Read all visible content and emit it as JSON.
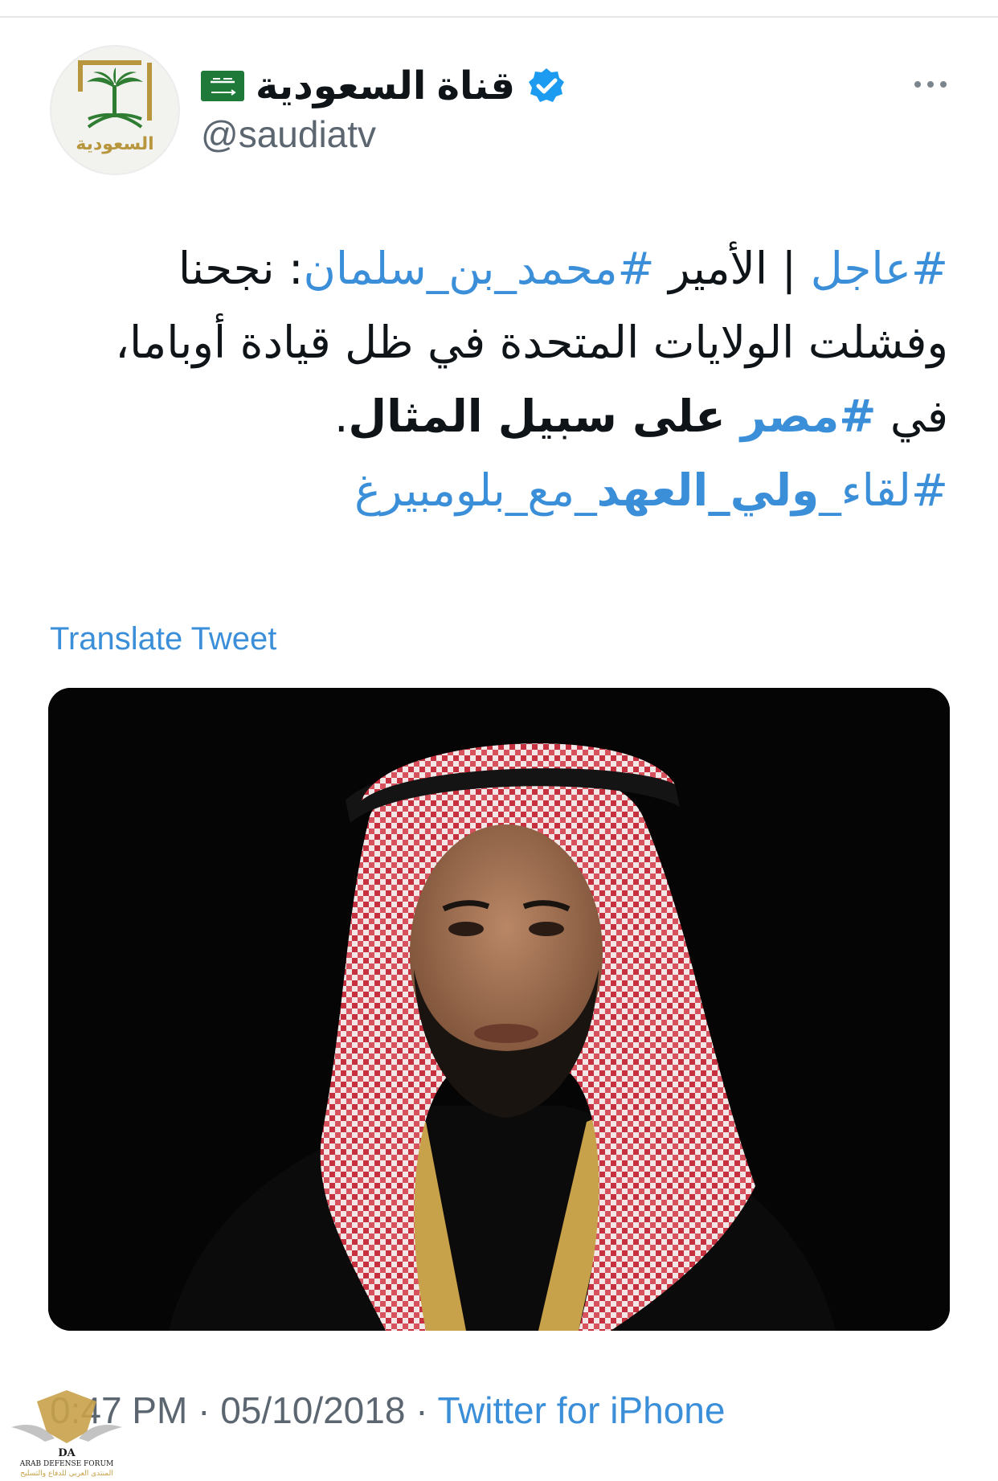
{
  "account": {
    "display_name": "قناة السعودية",
    "handle": "@saudiatv",
    "avatar_text": "السعودية",
    "flag_emoji_name": "saudi-arabia-flag",
    "verified_icon": "verified-badge-icon"
  },
  "tweet": {
    "line1_hashtag_ajel": "#عاجل",
    "line1_sep": " | الأمير ",
    "line1_hashtag_mbs": "#محمد_بن_سلمان",
    "line1_rest": ": نجحنا",
    "line2": "وفشلت الولايات المتحدة في ظل قيادة أوباما،",
    "line3_prefix": "في ",
    "line3_hashtag": "#مصر",
    "line3_bold": " على سبيل المثال",
    "line3_end": ".",
    "tag_part1": "#لقاء_",
    "tag_part2_bold": "ولي_العهد",
    "tag_part3": "_مع_بلومبيرغ"
  },
  "translate_label": "Translate Tweet",
  "meta": {
    "time": "0:47 PM",
    "separator": " · ",
    "date": "05/10/2018",
    "source": "Twitter for iPhone"
  },
  "watermark": {
    "line1": "ARAB DEFENSE FORUM",
    "line2": "المنتدى العربي للدفاع والتسليح",
    "monogram": "DA"
  },
  "colors": {
    "link": "#3b8fd9",
    "verified": "#1d9bf0",
    "secondary_text": "#5b6670",
    "logo_gold": "#b8963e",
    "logo_green": "#2e7d32"
  }
}
